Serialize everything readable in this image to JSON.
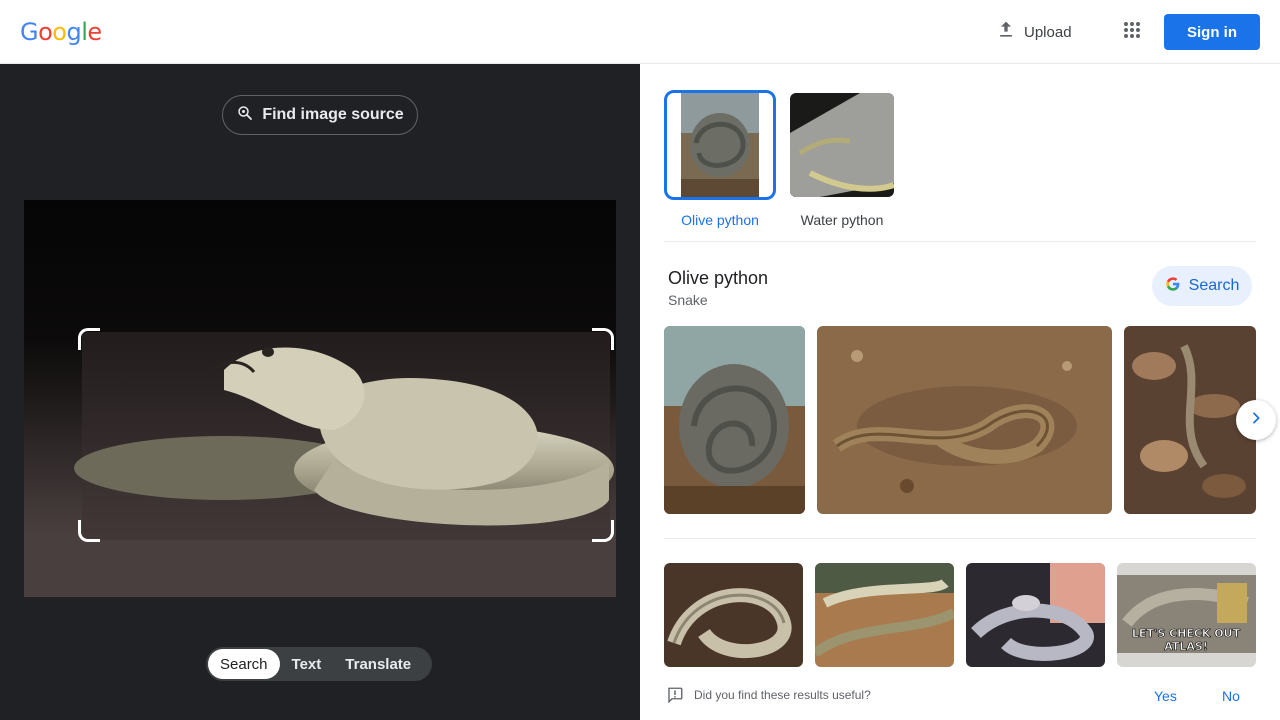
{
  "header": {
    "logo_letters": [
      "G",
      "o",
      "o",
      "g",
      "l",
      "e"
    ],
    "logo_colors": [
      "#4285f4",
      "#ea4335",
      "#fbbc05",
      "#4285f4",
      "#34a853",
      "#ea4335"
    ],
    "upload_label": "Upload",
    "upload_icon": "upload-icon",
    "apps_icon": "apps-grid-icon",
    "signin_label": "Sign in"
  },
  "left": {
    "find_source_label": "Find image source",
    "find_source_icon": "lens-search-icon",
    "modes": [
      {
        "label": "Search",
        "active": true
      },
      {
        "label": "Text",
        "active": false
      },
      {
        "label": "Translate",
        "active": false
      }
    ]
  },
  "right": {
    "choices": [
      {
        "label": "Olive python",
        "selected": true
      },
      {
        "label": "Water python",
        "selected": false
      }
    ],
    "entity": {
      "title": "Olive python",
      "subtitle": "Snake",
      "search_label": "Search"
    },
    "result_overlay_text": "LET'S CHECK OUT ATLAS!",
    "feedback": {
      "question": "Did you find these results useful?",
      "yes": "Yes",
      "no": "No"
    }
  },
  "colors": {
    "accent": "#1a73e8",
    "dark_panel": "#202124"
  }
}
